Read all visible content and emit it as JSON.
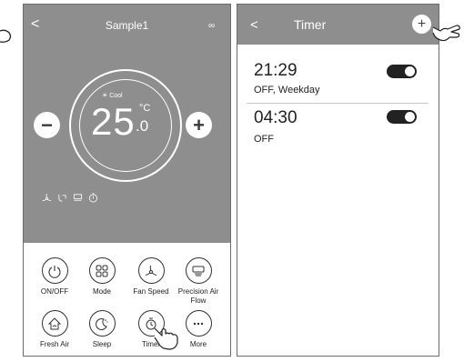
{
  "left": {
    "back": "<",
    "title": "Sample1",
    "more": "∞",
    "mode": "☀ Cool",
    "temp_int": "25",
    "temp_unit": "°C",
    "temp_dec": ".0",
    "minus": "−",
    "plus": "+",
    "status_icons": [
      "fan-icon",
      "airflow-icon",
      "louver-icon",
      "timer-icon"
    ],
    "features": [
      {
        "label": "ON/OFF",
        "icon": "power-icon"
      },
      {
        "label": "Mode",
        "icon": "mode-icon"
      },
      {
        "label": "Fan Speed",
        "icon": "fan-icon"
      },
      {
        "label": "Precision Air Flow",
        "icon": "airflow-icon"
      },
      {
        "label": "Fresh Air",
        "icon": "fresh-air-icon"
      },
      {
        "label": "Sleep",
        "icon": "sleep-icon"
      },
      {
        "label": "Timer",
        "icon": "timer-icon"
      },
      {
        "label": "More",
        "icon": "more-icon"
      }
    ]
  },
  "right": {
    "back": "<",
    "title": "Timer",
    "add": "+",
    "timers": [
      {
        "time": "21:29",
        "sub": "OFF, Weekday",
        "enabled": true
      },
      {
        "time": "04:30",
        "sub": "OFF",
        "enabled": true
      }
    ]
  },
  "colors": {
    "header": "#8e8e8e",
    "toggle": "#222222"
  }
}
